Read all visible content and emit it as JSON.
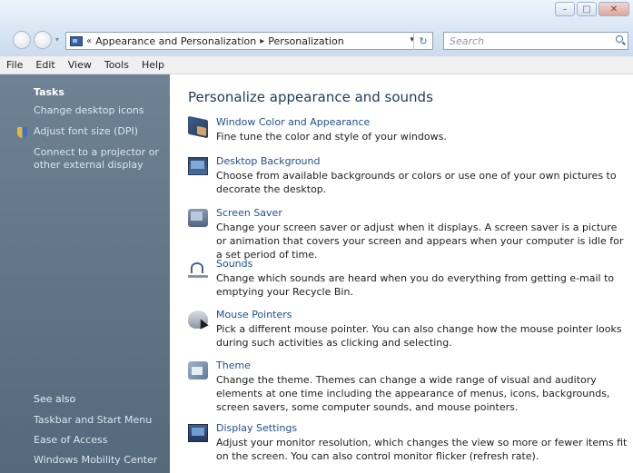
{
  "window": {
    "caption_minimize": "–",
    "caption_maximize": "□",
    "caption_close": "✕"
  },
  "addressbar": {
    "overflow": "«",
    "crumbs": [
      "Appearance and Personalization",
      "Personalization"
    ],
    "separator": "▸",
    "dropdown": "▾",
    "refresh": "↻"
  },
  "search": {
    "placeholder": "Search"
  },
  "menubar": {
    "items": [
      "File",
      "Edit",
      "View",
      "Tools",
      "Help"
    ]
  },
  "taskpane": {
    "tasks_heading": "Tasks",
    "tasks": [
      "Change desktop icons",
      "Adjust font size (DPI)",
      "Connect to a projector or other external display"
    ],
    "see_also_heading": "See also",
    "see_also": [
      "Taskbar and Start Menu",
      "Ease of Access",
      "Windows Mobility Center"
    ]
  },
  "main": {
    "title": "Personalize appearance and sounds",
    "items": [
      {
        "icon": "window-color-icon",
        "label": "Window Color and Appearance",
        "desc": "Fine tune the color and style of your windows."
      },
      {
        "icon": "desktop-background-icon",
        "label": "Desktop Background",
        "desc": "Choose from available backgrounds or colors or use one of your own pictures to decorate the desktop."
      },
      {
        "icon": "screen-saver-icon",
        "label": "Screen Saver",
        "desc": "Change your screen saver or adjust when it displays. A screen saver is a picture or animation that covers your screen and appears when your computer is idle for a set period of time."
      },
      {
        "icon": "sounds-icon",
        "label": "Sounds",
        "desc": "Change which sounds are heard when you do everything from getting e-mail to emptying your Recycle Bin."
      },
      {
        "icon": "mouse-pointer-icon",
        "label": "Mouse Pointers",
        "desc": "Pick a different mouse pointer. You can also change how the mouse pointer looks during such activities as clicking and selecting."
      },
      {
        "icon": "theme-icon",
        "label": "Theme",
        "desc": "Change the theme. Themes can change a wide range of visual and auditory elements at one time including the appearance of menus, icons, backgrounds, screen savers, some computer sounds, and mouse pointers."
      },
      {
        "icon": "display-settings-icon",
        "label": "Display Settings",
        "desc": "Adjust your monitor resolution, which changes the view so more or fewer items fit on the screen. You can also control monitor flicker (refresh rate)."
      }
    ]
  }
}
